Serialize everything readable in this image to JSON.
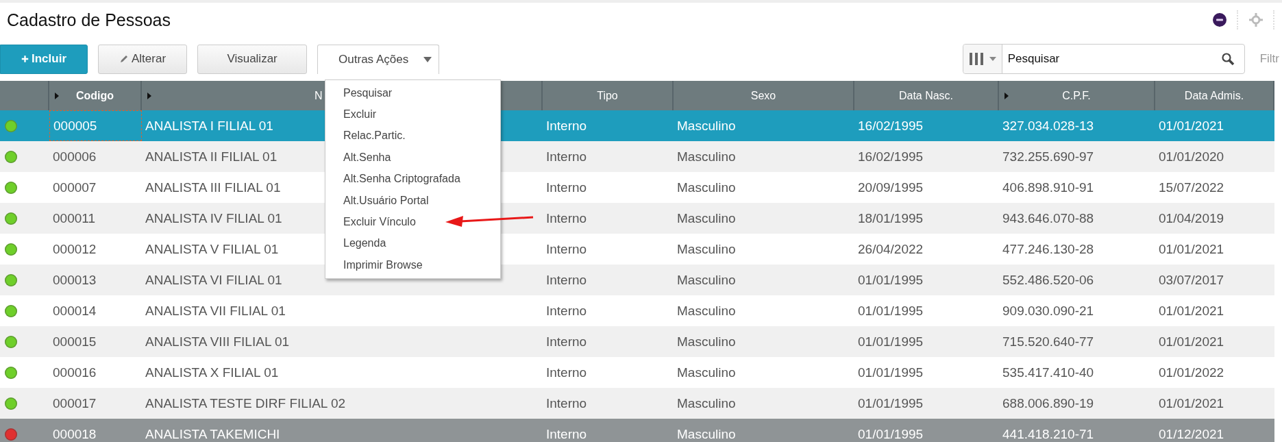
{
  "title": "Cadastro de Pessoas",
  "buttons": [
    {
      "label": "Incluir",
      "kind": "primary"
    },
    {
      "label": "Alterar",
      "kind": "edit"
    },
    {
      "label": "Visualizar",
      "kind": "plain"
    },
    {
      "label": "Outras Ações",
      "kind": "dropdown",
      "expanded": true
    }
  ],
  "menu": [
    {
      "label": "Pesquisar",
      "annotated": false
    },
    {
      "label": "Excluir",
      "annotated": false
    },
    {
      "label": "Relac.Partic.",
      "annotated": false
    },
    {
      "label": "Alt.Senha",
      "annotated": false
    },
    {
      "label": "Alt.Senha Criptografada",
      "annotated": false
    },
    {
      "label": "Alt.Usuário Portal",
      "annotated": false
    },
    {
      "label": "Excluir Vínculo",
      "annotated": true
    },
    {
      "label": "Legenda",
      "annotated": false
    },
    {
      "label": "Imprimir Browse",
      "annotated": false
    }
  ],
  "search": {
    "placeholder": "Pesquisar"
  },
  "filter_label": "Filtr",
  "table": {
    "columns": [
      {
        "label": "Codigo",
        "sortable": true
      },
      {
        "label": "N",
        "sortable": true
      },
      {
        "label": "Tipo",
        "sortable": false
      },
      {
        "label": "Sexo",
        "sortable": false
      },
      {
        "label": "Data Nasc.",
        "sortable": false
      },
      {
        "label": "C.P.F.",
        "sortable": true
      },
      {
        "label": "Data Admis.",
        "sortable": false
      }
    ],
    "rows": [
      {
        "color": "#6fcf2a",
        "selected": true,
        "dimmed": false,
        "cells": [
          "000005",
          "ANALISTA I FILIAL 01",
          "Interno",
          "Masculino",
          "16/02/1995",
          "327.034.028-13",
          "01/01/2021"
        ]
      },
      {
        "color": "#6fcf2a",
        "selected": false,
        "dimmed": false,
        "cells": [
          "000006",
          "ANALISTA II FILIAL 01",
          "Interno",
          "Masculino",
          "16/02/1995",
          "732.255.690-97",
          "01/01/2020"
        ]
      },
      {
        "color": "#6fcf2a",
        "selected": false,
        "dimmed": false,
        "cells": [
          "000007",
          "ANALISTA III FILIAL 01",
          "Interno",
          "Masculino",
          "20/09/1995",
          "406.898.910-91",
          "15/07/2022"
        ]
      },
      {
        "color": "#6fcf2a",
        "selected": false,
        "dimmed": false,
        "cells": [
          "000011",
          "ANALISTA IV FILIAL 01",
          "Interno",
          "Masculino",
          "18/01/1995",
          "943.646.070-88",
          "01/04/2019"
        ]
      },
      {
        "color": "#6fcf2a",
        "selected": false,
        "dimmed": false,
        "cells": [
          "000012",
          "ANALISTA V FILIAL 01",
          "Interno",
          "Masculino",
          "26/04/2022",
          "477.246.130-28",
          "01/01/2021"
        ]
      },
      {
        "color": "#6fcf2a",
        "selected": false,
        "dimmed": false,
        "cells": [
          "000013",
          "ANALISTA VI FILIAL 01",
          "Interno",
          "Masculino",
          "01/01/1995",
          "552.486.520-06",
          "03/07/2017"
        ]
      },
      {
        "color": "#6fcf2a",
        "selected": false,
        "dimmed": false,
        "cells": [
          "000014",
          "ANALISTA VII FILIAL 01",
          "Interno",
          "Masculino",
          "01/01/1995",
          "909.030.090-21",
          "01/01/2021"
        ]
      },
      {
        "color": "#6fcf2a",
        "selected": false,
        "dimmed": false,
        "cells": [
          "000015",
          "ANALISTA VIII FILIAL 01",
          "Interno",
          "Masculino",
          "01/01/1995",
          "715.520.640-77",
          "01/01/2021"
        ]
      },
      {
        "color": "#6fcf2a",
        "selected": false,
        "dimmed": false,
        "cells": [
          "000016",
          "ANALISTA X FILIAL 01",
          "Interno",
          "Masculino",
          "01/01/1995",
          "535.417.410-40",
          "01/01/2022"
        ]
      },
      {
        "color": "#6fcf2a",
        "selected": false,
        "dimmed": false,
        "cells": [
          "000017",
          "ANALISTA TESTE DIRF FILIAL 02",
          "Interno",
          "Masculino",
          "01/01/1995",
          "688.006.890-19",
          "01/01/2021"
        ]
      },
      {
        "color": "#e03030",
        "selected": false,
        "dimmed": true,
        "cells": [
          "000018",
          "ANALISTA TAKEMICHI",
          "Interno",
          "Masculino",
          "01/01/1995",
          "441.418.210-71",
          "01/12/2021"
        ]
      }
    ]
  }
}
